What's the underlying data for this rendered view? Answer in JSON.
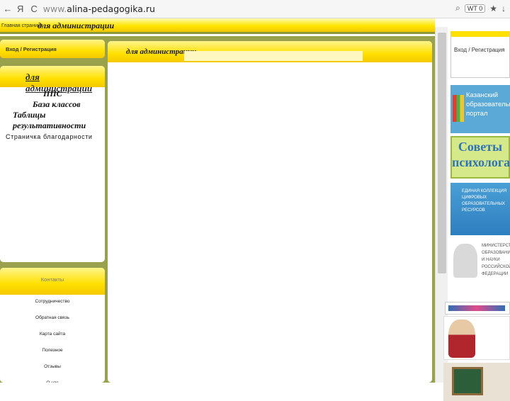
{
  "browser": {
    "nav_back": "←",
    "ya": "Я",
    "reload": "C",
    "url_scheme": "www.",
    "url_host": "alina-pedagogika.ru",
    "search_icon": "⌕",
    "badge": "WT 0",
    "star": "★",
    "download": "↓"
  },
  "header": {
    "home_link": "Главная страница",
    "title": "для администрации"
  },
  "sidebar": {
    "login": "Вход / Регистрация",
    "admin_heading": "для администрации",
    "menu": [
      "ППС",
      "База классов",
      "Таблицы результативности",
      "Страничка благодарности"
    ]
  },
  "contacts": {
    "heading": "Контакты",
    "items": [
      "Сотрудничество",
      "Обратная связь",
      "Карта сайта",
      "Полезное",
      "Отзывы",
      "О нас"
    ]
  },
  "main": {
    "title": "для администрации"
  },
  "right_column": {
    "login": "Вход / Регистрация",
    "banner1": "Казанский образовательный портал",
    "banner2": "Советы психолога",
    "banner3": "ЕДИНАЯ КОЛЛЕКЦИЯ ЦИФРОВЫХ ОБРАЗОВАТЕЛЬНЫХ РЕСУРСОВ",
    "banner4": "МИНИСТЕРСТВО ОБРАЗОВАНИЯ И НАУКИ РОССИЙСКОЙ ФЕДЕРАЦИИ"
  },
  "colors": {
    "accent_yellow": "#ffe000",
    "olive": "#9aa14c"
  }
}
